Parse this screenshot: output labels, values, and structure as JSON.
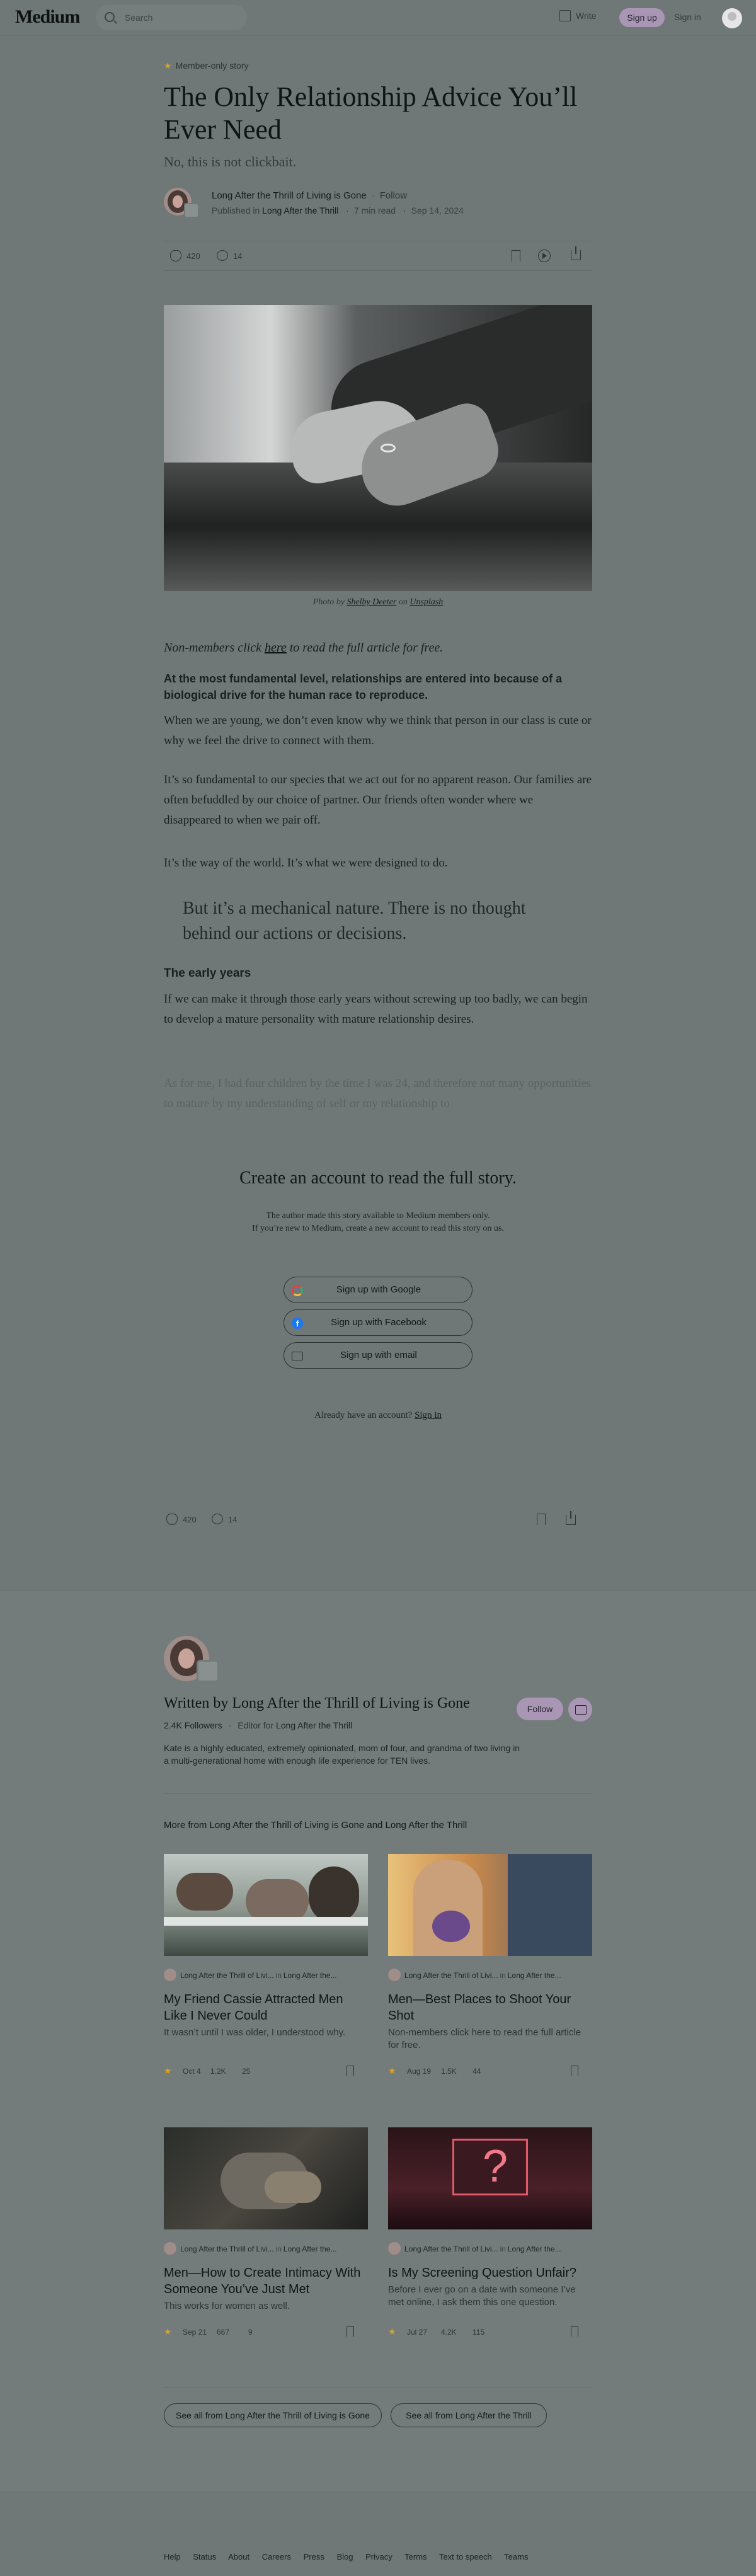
{
  "header": {
    "logo": "Medium",
    "search_placeholder": "Search",
    "write": "Write",
    "signup": "Sign up",
    "signin": "Sign in"
  },
  "article": {
    "badge": "Member-only story",
    "title": "The Only Relationship Advice You’ll Ever Need",
    "subtitle": "No, this is not clickbait.",
    "author": "Long After the Thrill of Living is Gone",
    "follow": "Follow",
    "published_in_label": "Published in",
    "publication": "Long After the Thrill",
    "read_time": "7 min read",
    "date": "Sep 14, 2024",
    "claps": "420",
    "comments": "14",
    "caption_prefix": "Photo by",
    "photographer": "Shelby Deeter",
    "caption_on": "on",
    "photo_source": "Unsplash",
    "nonmember_prefix": "Non-members click",
    "nonmember_link": "here",
    "nonmember_suffix": "to read the full article for free.",
    "lead": "At the most fundamental level, relationships are entered into because of a biological drive for the human race to reproduce.",
    "p1": "When we are young, we don’t even know why we think that person in our class is cute or why we feel the drive to connect with them.",
    "p2": "It’s so fundamental to our species that we act out for no apparent reason. Our families are often befuddled by our choice of partner. Our friends often wonder where we disappeared to when we pair off.",
    "p3": "It’s the way of the world. It’s what we were designed to do.",
    "pullquote": "But it’s a mechanical nature. There is no thought behind our actions or decisions.",
    "subhead": "The early years",
    "p4": "If we can make it through those early years without screwing up too badly, we can begin to develop a mature personality with mature relationship desires.",
    "p5": "As for me, I had four children by the time I was 24, and therefore not many opportunities to mature by my understanding of self or my relationship to"
  },
  "paywall": {
    "title": "Create an account to read the full story.",
    "line1": "The author made this story available to Medium members only.",
    "line2": "If you’re new to Medium, create a new account to read this story on us.",
    "google": "Sign up with Google",
    "facebook": "Sign up with Facebook",
    "email": "Sign up with email",
    "already": "Already have an account?",
    "signin": "Sign in"
  },
  "author_section": {
    "written_by": "Written by Long After the Thrill of Living is Gone",
    "followers": "2.4K Followers",
    "editor_for_label": "Editor for",
    "editor_for": "Long After the Thrill",
    "bio": "Kate is a highly educated, extremely opinionated, mom of four, and grandma of two living in a multi-generational home with enough life experience for TEN lives.",
    "follow": "Follow",
    "more_from": "More from Long After the Thrill of Living is Gone and Long After the Thrill",
    "cards": [
      {
        "author": "Long After the Thrill of Livi...",
        "in": "in",
        "pub": "Long After the...",
        "title": "My Friend Cassie Attracted Men Like I Never Could",
        "sub": "It wasn’t until I was older, I understood why.",
        "date": "Oct 4",
        "claps": "1.2K",
        "comments": "25"
      },
      {
        "author": "Long After the Thrill of Livi...",
        "in": "in",
        "pub": "Long After the...",
        "title": "Men—Best Places to Shoot Your Shot",
        "sub": "Non-members click here to read the full article for free.",
        "date": "Aug 19",
        "claps": "1.5K",
        "comments": "44"
      },
      {
        "author": "Long After the Thrill of Livi...",
        "in": "in",
        "pub": "Long After the...",
        "title": "Men—How to Create Intimacy With Someone You’ve Just Met",
        "sub": "This works for women as well.",
        "date": "Sep 21",
        "claps": "667",
        "comments": "9"
      },
      {
        "author": "Long After the Thrill of Livi...",
        "in": "in",
        "pub": "Long After the...",
        "title": "Is My Screening Question Unfair?",
        "sub": "Before I ever go on a date with someone I’ve met online, I ask them this one question.",
        "date": "Jul 27",
        "claps": "4.2K",
        "comments": "115"
      }
    ],
    "see_all_author": "See all from Long After the Thrill of Living is Gone",
    "see_all_pub": "See all from Long After the Thrill"
  },
  "footer": {
    "links": [
      "Help",
      "Status",
      "About",
      "Careers",
      "Press",
      "Blog",
      "Privacy",
      "Terms",
      "Text to speech",
      "Teams"
    ]
  },
  "colors": {
    "accent": "#a996b5",
    "star": "#d9a426",
    "background": "#6f7777"
  }
}
